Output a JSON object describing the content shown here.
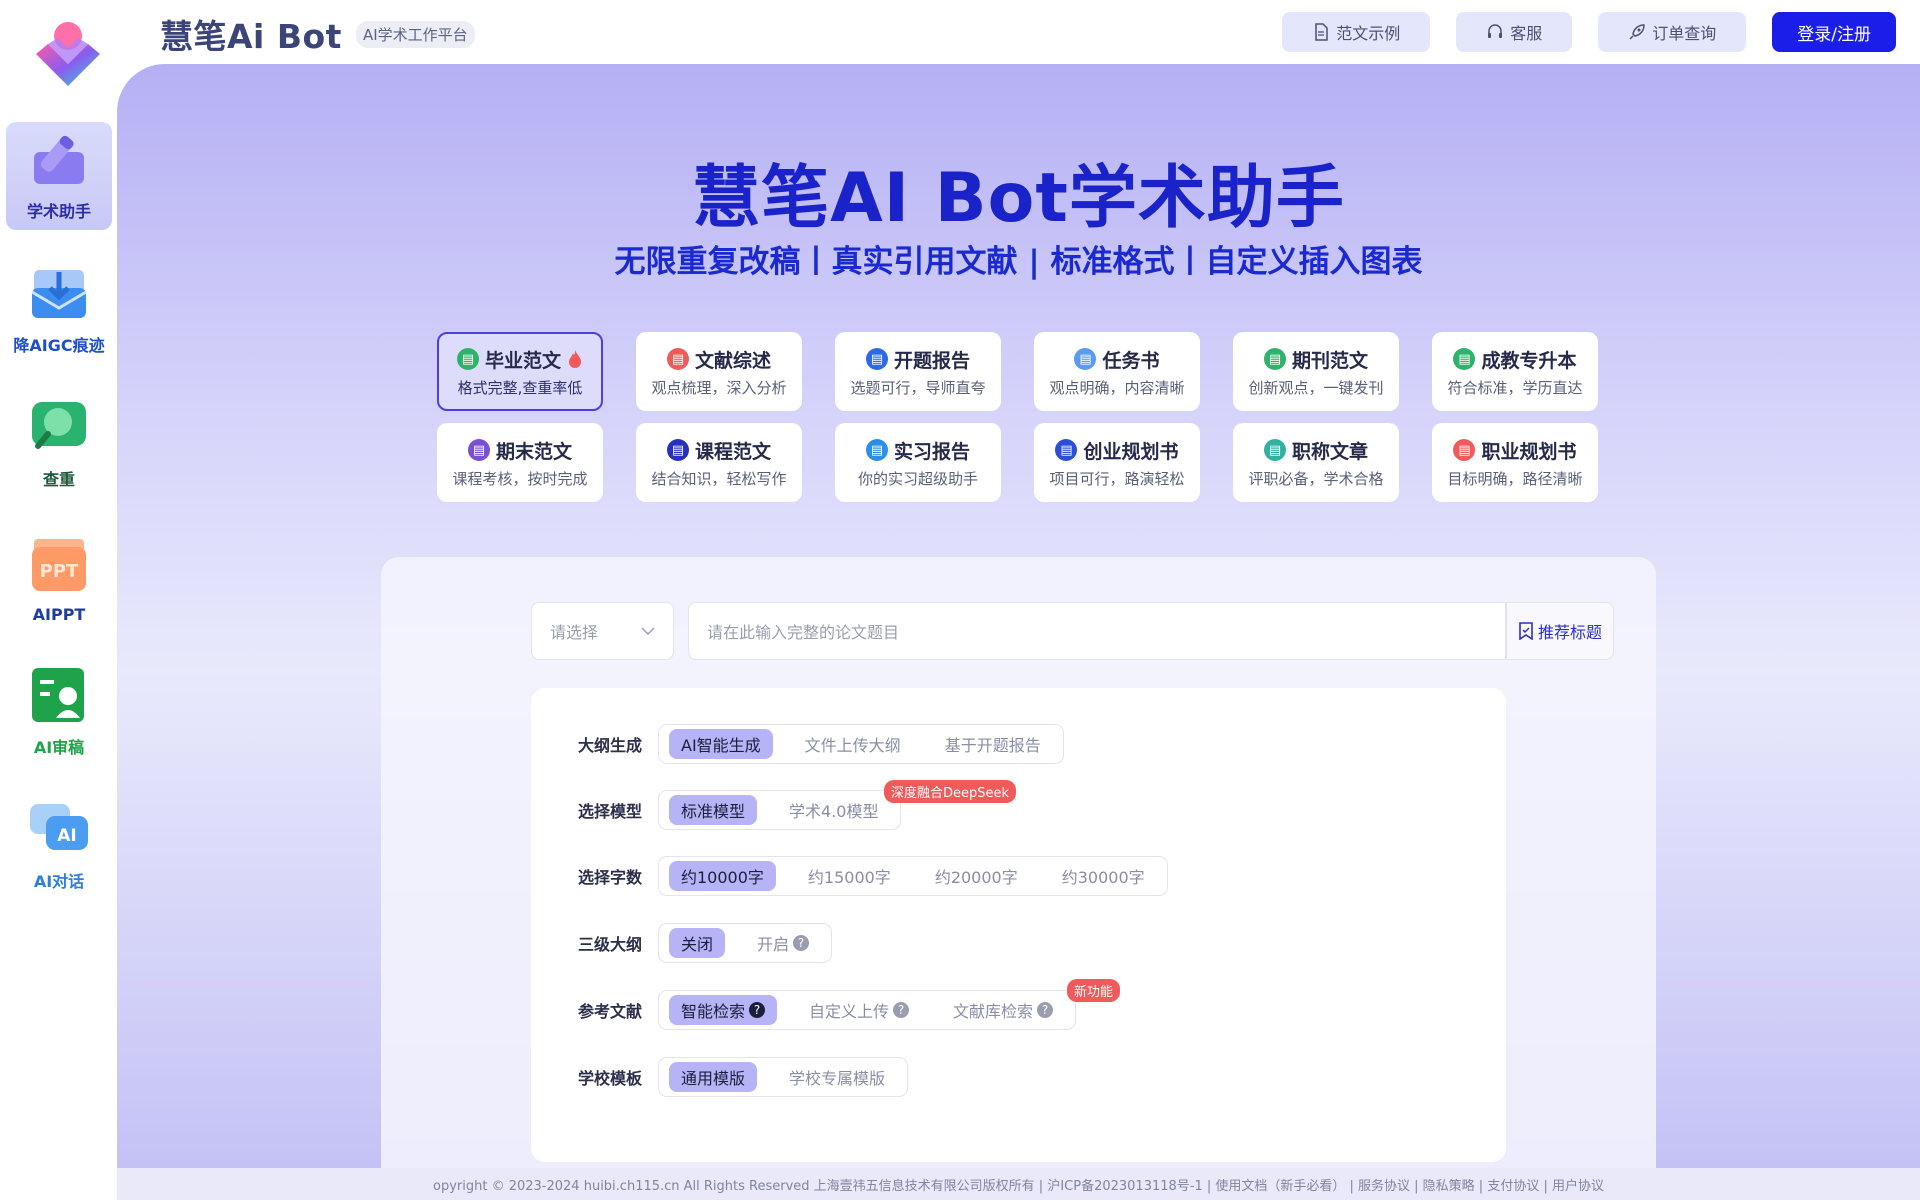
{
  "brand": {
    "name": "慧笔Ai Bot",
    "tag": "AI学术工作平台"
  },
  "top_actions": [
    {
      "label": "范文示例",
      "icon": "document-icon"
    },
    {
      "label": "客服",
      "icon": "headset-icon"
    },
    {
      "label": "订单查询",
      "icon": "rocket-icon"
    }
  ],
  "login_label": "登录/注册",
  "sidebar": {
    "items": [
      {
        "label": "学术助手",
        "color": "#2c2fa8",
        "icon": "pen-icon",
        "active": true
      },
      {
        "label": "降AIGC痕迹",
        "color": "#1f4fc8",
        "icon": "download-mail-icon"
      },
      {
        "label": "查重",
        "color": "#1e5a3a",
        "icon": "magnifier-icon"
      },
      {
        "label": "AIPPT",
        "color": "#1f3da0",
        "icon": "ppt-icon"
      },
      {
        "label": "AI审稿",
        "color": "#1fa34a",
        "icon": "reviewer-icon"
      },
      {
        "label": "AI对话",
        "color": "#2b7de0",
        "icon": "chat-ai-icon"
      }
    ]
  },
  "hero": {
    "title": "慧笔AI Bot学术助手",
    "subtitle": "无限重复改稿丨真实引用文献 | 标准格式丨自定义插入图表"
  },
  "cards": [
    {
      "title": "毕业范文",
      "desc": "格式完整,查重率低",
      "icon_color": "#2fb36c",
      "active": true
    },
    {
      "title": "文献综述",
      "desc": "观点梳理，深入分析",
      "icon_color": "#ef5b5b"
    },
    {
      "title": "开题报告",
      "desc": "选题可行，导师直夸",
      "icon_color": "#2d6be6"
    },
    {
      "title": "任务书",
      "desc": "观点明确，内容清晰",
      "icon_color": "#5b9cf0"
    },
    {
      "title": "期刊范文",
      "desc": "创新观点，一键发刊",
      "icon_color": "#2fb36c"
    },
    {
      "title": "成教专升本",
      "desc": "符合标准，学历直达",
      "icon_color": "#2fb36c"
    },
    {
      "title": "期末范文",
      "desc": "课程考核，按时完成",
      "icon_color": "#7a4fd8"
    },
    {
      "title": "课程范文",
      "desc": "结合知识，轻松写作",
      "icon_color": "#2b2fc0"
    },
    {
      "title": "实习报告",
      "desc": "你的实习超级助手",
      "icon_color": "#2d8ee6"
    },
    {
      "title": "创业规划书",
      "desc": "项目可行，路演轻松",
      "icon_color": "#2d4fd8"
    },
    {
      "title": "职称文章",
      "desc": "评职必备，学术合格",
      "icon_color": "#2fb3a0"
    },
    {
      "title": "职业规划书",
      "desc": "目标明确，路径清晰",
      "icon_color": "#ef5b5b"
    }
  ],
  "form": {
    "select_placeholder": "请选择",
    "title_placeholder": "请在此输入完整的论文题目",
    "recommend_label": "推荐标题",
    "rows": {
      "outline": {
        "label": "大纲生成",
        "options": [
          "AI智能生成",
          "文件上传大纲",
          "基于开题报告"
        ]
      },
      "model": {
        "label": "选择模型",
        "options": [
          "标准模型",
          "学术4.0模型"
        ],
        "badge": "深度融合DeepSeek"
      },
      "words": {
        "label": "选择字数",
        "options": [
          "约10000字",
          "约15000字",
          "约20000字",
          "约30000字"
        ]
      },
      "level3": {
        "label": "三级大纲",
        "options": [
          "关闭",
          "开启"
        ]
      },
      "refs": {
        "label": "参考文献",
        "options": [
          "智能检索",
          "自定义上传",
          "文献库检索"
        ],
        "badge": "新功能"
      },
      "template": {
        "label": "学校模板",
        "options": [
          "通用模版",
          "学校专属模版"
        ]
      }
    }
  },
  "footer": "opyright © 2023-2024 huibi.ch115.cn All Rights Reserved 上海壹祎五信息技术有限公司版权所有 | 沪ICP备2023013118号-1 | 使用文档（新手必看） | 服务协议 | 隐私策略 | 支付协议 | 用户协议"
}
